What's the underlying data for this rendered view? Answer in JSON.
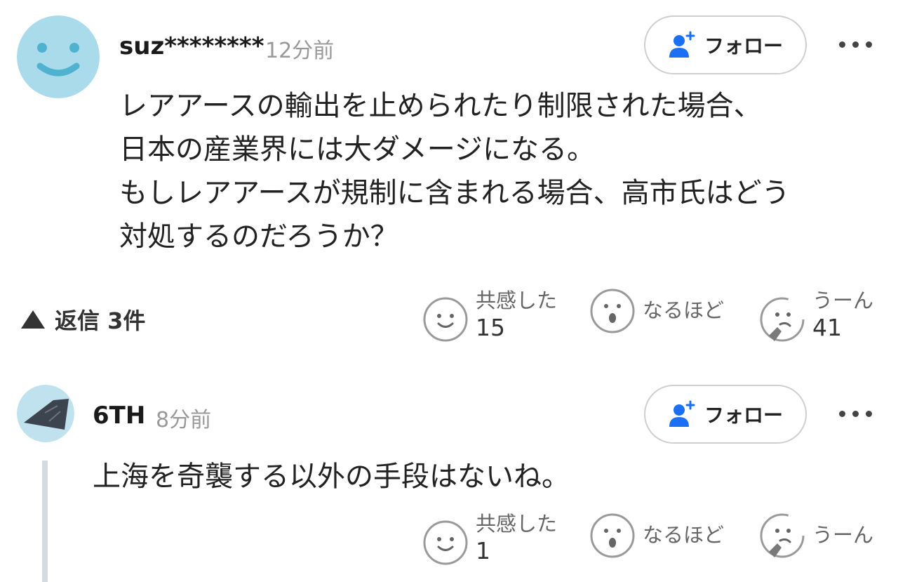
{
  "comments": [
    {
      "username": "suz********",
      "time": "12分前",
      "follow_label": "フォロー",
      "text_lines": [
        "レアアースの輸出を止められたり制限された場合、",
        "日本の産業界には大ダメージになる。",
        "もしレアアースが規制に含まれる場合、高市氏はどう",
        "対処するのだろうか？"
      ],
      "replies_label": "返信 3件",
      "reactions": [
        {
          "label": "共感した",
          "count": "15"
        },
        {
          "label": "なるほど",
          "count": ""
        },
        {
          "label": "うーん",
          "count": "41"
        }
      ]
    },
    {
      "username": "6TH",
      "time": "8分前",
      "follow_label": "フォロー",
      "text_lines": [
        "上海を奇襲する以外の手段はないね。"
      ],
      "reactions": [
        {
          "label": "共感した",
          "count": "1"
        },
        {
          "label": "なるほど",
          "count": ""
        },
        {
          "label": "うーん",
          "count": ""
        }
      ]
    }
  ],
  "colors": {
    "follow_icon": "#1a6ff2",
    "avatar1_bg": "#a9dbeb",
    "avatar1_face": "#4fb3cf",
    "avatar2_bg": "#bfe2ee",
    "thread_line": "#d6dbe0"
  }
}
